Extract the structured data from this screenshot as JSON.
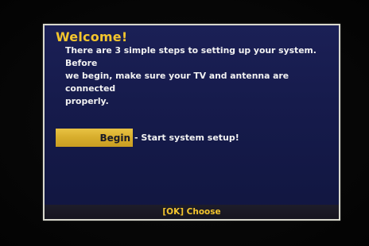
{
  "dialog": {
    "title": "Welcome!",
    "intro": "There are 3 simple steps to setting up your system.  Before\nwe begin, make sure your TV and antenna are connected\nproperly.",
    "begin_button": "Begin",
    "begin_description": "- Start system setup!",
    "footer_hint": "[OK] Choose"
  },
  "colors": {
    "accent": "#f3c52d",
    "dialog_background": "#161b4c",
    "dialog_border": "#d8d8cc",
    "text": "#f2f2f2",
    "button_fill": "#d7ad2c"
  }
}
